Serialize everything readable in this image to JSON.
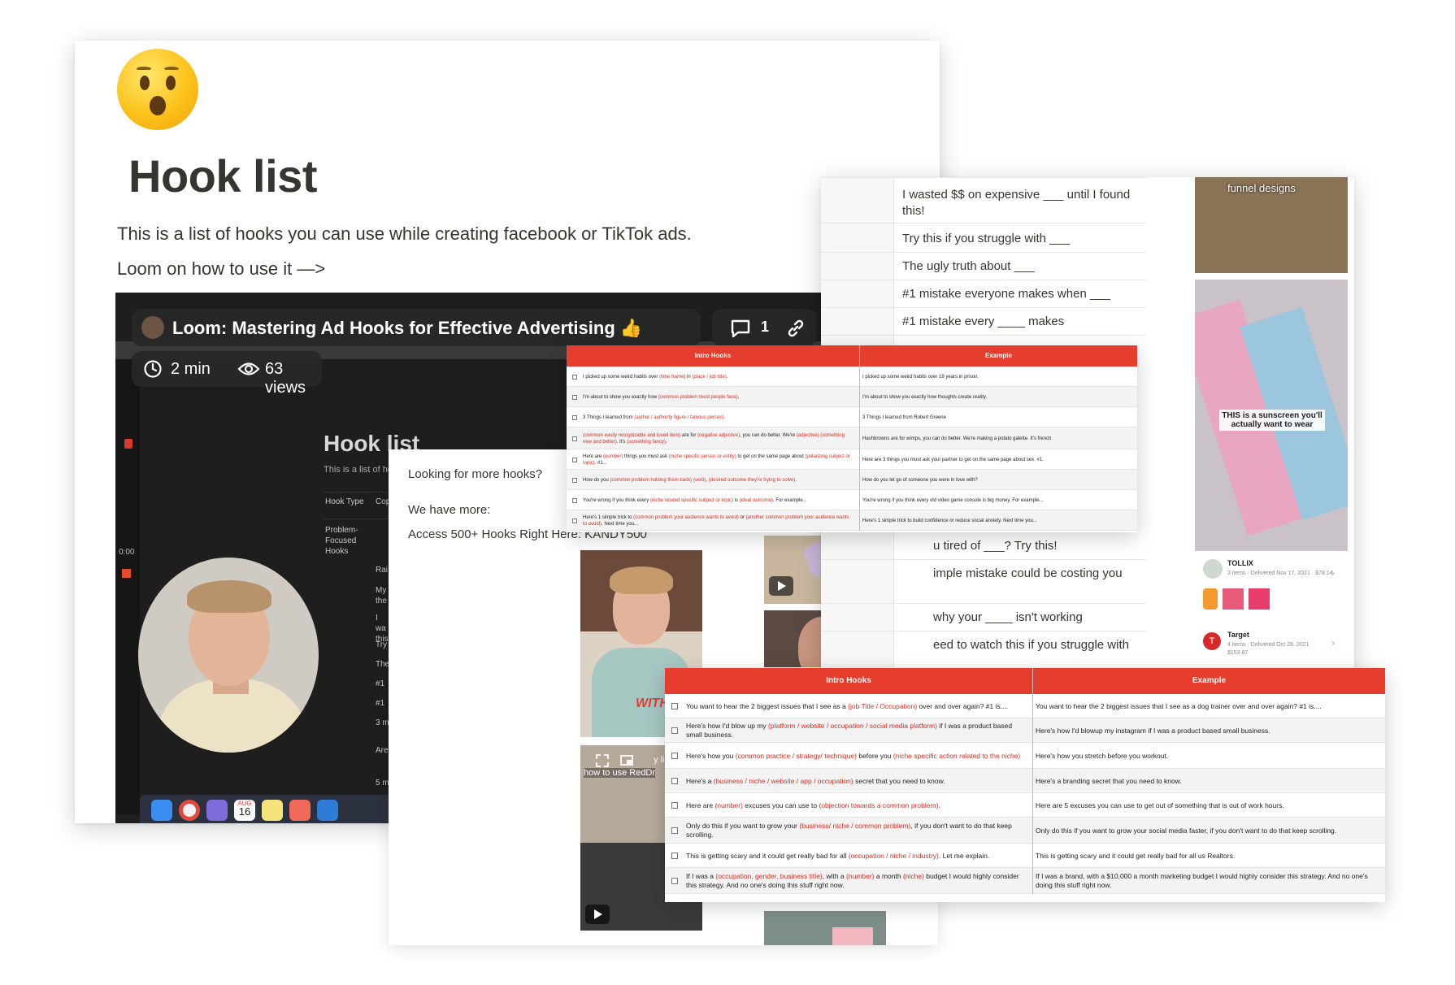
{
  "page": {
    "title": "Hook list",
    "description": "This is a list of hooks you can use while creating facebook or TikTok ads.",
    "loom_link_text": "Loom on how to use it —>"
  },
  "loom": {
    "title": "Loom: Mastering Ad Hooks for Effective Advertising 👍",
    "comment_count": "1",
    "duration": "2 min",
    "views": "63 views",
    "timer": "0:00",
    "inner_title": "Hook list",
    "inner_desc": "This is a list of ho",
    "inner_col_head": "Hook Type",
    "inner_col_head2": "Cop",
    "inner_row_label": "Problem-Focused Hooks",
    "inner_snippets": [
      "Rai",
      "My the",
      "I wa this",
      "Try",
      "The",
      "#1",
      "#1",
      "3 m",
      "Are",
      "5 m"
    ],
    "dock_date_month": "AUG",
    "dock_date_day": "16"
  },
  "more_hooks": {
    "question": "Looking for more hooks?",
    "have_more": "We have more:",
    "access": "Access 500+ Hooks Right Here: KANDY500",
    "thumb_caption_1": "WITH",
    "thumb_caption_2": "how to use RedDr",
    "thumb_caption_2b": "y littl"
  },
  "hook_list": {
    "rows": [
      "I wasted $$ on expensive ___ until I found this!",
      "Try this if you struggle with ___",
      "The ugly truth about ___",
      "#1 mistake everyone makes when ___",
      "#1 mistake every ____ makes"
    ],
    "lower_rows": [
      "u tired of ___? Try this!",
      "imple mistake could be costing you",
      "why your ____ isn't working",
      "eed to watch this if you struggle with"
    ],
    "image_caption_1": "funnel designs",
    "image_caption_2": "THIS is a sunscreen you'll actually want to wear",
    "order_1_store": "TOLLIX",
    "order_1_meta": "3 items · Delivered Nov 17, 2021 · $78.14",
    "order_2_store": "Target",
    "order_2_meta": "4 items · Delivered Oct 28, 2021",
    "order_2_price": "$153.87"
  },
  "table_small": {
    "headers": [
      "Intro Hooks",
      "Example"
    ],
    "rows": [
      {
        "hook": [
          [
            "I picked up some weird habits over ",
            ""
          ],
          [
            "(time frame)",
            "red"
          ],
          [
            " in ",
            ""
          ],
          [
            "(place / job title)",
            "red"
          ],
          [
            ".",
            ""
          ]
        ],
        "example": "I picked up some weird habits over 19 years in prison."
      },
      {
        "hook": [
          [
            "I'm about to show you exactly how ",
            ""
          ],
          [
            "(common problem most people face)",
            "red"
          ],
          [
            ".",
            ""
          ]
        ],
        "example": "I'm about to show you exactly how thoughts create reality."
      },
      {
        "hook": [
          [
            "3 Things I learned from ",
            ""
          ],
          [
            "(author / authority figure / famous person)",
            "red"
          ],
          [
            ".",
            ""
          ]
        ],
        "example": "3 Things I learned from Robert Greene"
      },
      {
        "hook": [
          [
            "(common easily recognizable and loved item)",
            "red"
          ],
          [
            " are for ",
            ""
          ],
          [
            "(negative adjective)",
            "red"
          ],
          [
            ", you can do better. We're ",
            ""
          ],
          [
            "(adjective)",
            "red"
          ],
          [
            " ",
            ""
          ],
          [
            "(something new and better)",
            "red"
          ],
          [
            ". It's ",
            ""
          ],
          [
            "(something fancy)",
            "red"
          ],
          [
            ".",
            ""
          ]
        ],
        "example": "Hashbrowns are for wimps, you can do better. We're making a potato galette. It's french"
      },
      {
        "hook": [
          [
            "Here are ",
            ""
          ],
          [
            "(number)",
            "red"
          ],
          [
            " things you must ask ",
            ""
          ],
          [
            "(niche specific person or entity)",
            "red"
          ],
          [
            " to get on the same page about ",
            ""
          ],
          [
            "(polarizing subject or topic)",
            "red"
          ],
          [
            ". #1...",
            ""
          ]
        ],
        "example": "Here are 3 things you must ask your partner to get on the same page about sex. #1."
      },
      {
        "hook": [
          [
            "How do you ",
            ""
          ],
          [
            "(common problem holding them back)",
            "red"
          ],
          [
            " ",
            ""
          ],
          [
            "(verb)",
            "red"
          ],
          [
            ", ",
            ""
          ],
          [
            "(desired outcome they're trying to solve)",
            "red"
          ],
          [
            ".",
            ""
          ]
        ],
        "example": "How do you let go of someone you were in love with?"
      },
      {
        "hook": [
          [
            "You're wrong if you think every ",
            ""
          ],
          [
            "(niche related specific subject or topic)",
            "red"
          ],
          [
            " is ",
            ""
          ],
          [
            "(ideal outcome)",
            "red"
          ],
          [
            ". For example...",
            ""
          ]
        ],
        "example": "You're wrong if you think every old video game console is big money. For example..."
      },
      {
        "hook": [
          [
            "Here's 1 simple trick to ",
            ""
          ],
          [
            "(common problem your audience wants to avoid)",
            "red"
          ],
          [
            " or ",
            ""
          ],
          [
            "(another common problem your audience wants to avoid)",
            "red"
          ],
          [
            ". Next time you...",
            ""
          ]
        ],
        "example": "Here's 1 simple trick to build confidence or reduce social anxiety. Next time you..."
      }
    ]
  },
  "table_large": {
    "headers": [
      "Intro Hooks",
      "Example"
    ],
    "rows": [
      {
        "hook": [
          [
            "You want to hear the 2 biggest issues that I see as a ",
            ""
          ],
          [
            "(job Title / Occupation)",
            "red"
          ],
          [
            " over and over again? #1 is....",
            ""
          ]
        ],
        "example": "You want to hear the 2 biggest issues that I see as a dog trainer over and over again? #1 is...."
      },
      {
        "hook": [
          [
            "Here's how I'd blow up my ",
            ""
          ],
          [
            "(platform / website / occupation / social media platform)",
            "red"
          ],
          [
            " if I was a product based small business.",
            ""
          ]
        ],
        "example": "Here's how I'd blowup my instagram if I was a product based small business."
      },
      {
        "hook": [
          [
            "Here's how you ",
            ""
          ],
          [
            "(common practice / strategy/ technique)",
            "red"
          ],
          [
            " before you ",
            ""
          ],
          [
            "(niche specific action related to the niche)",
            "red"
          ]
        ],
        "example": "Here's how you stretch before you workout."
      },
      {
        "hook": [
          [
            "Here's a ",
            ""
          ],
          [
            "(business / niche / website / app / occupation)",
            "red"
          ],
          [
            " secret that you need to know.",
            ""
          ]
        ],
        "example": "Here's a branding secret that you need to know."
      },
      {
        "hook": [
          [
            "Here are ",
            ""
          ],
          [
            "(number)",
            "red"
          ],
          [
            " excuses you can use to ",
            ""
          ],
          [
            "(objection towards a common problem)",
            "red"
          ],
          [
            ".",
            ""
          ]
        ],
        "example": "Here are 5 excuses you can use to get out of something that is out of work hours."
      },
      {
        "hook": [
          [
            "Only do this if you want to grow your ",
            ""
          ],
          [
            "(business/ niche / common problem)",
            "red"
          ],
          [
            ", if you don't want to do that keep scrolling.",
            ""
          ]
        ],
        "example": "Only do this if you want to grow your social media faster, if you don't want to do that keep scrolling."
      },
      {
        "hook": [
          [
            "This is getting scary and it could get really bad for all ",
            ""
          ],
          [
            "(occupation / niche / industry)",
            "red"
          ],
          [
            ". Let me explain.",
            ""
          ]
        ],
        "example": "This is getting scary and it could get really bad for all us Realtors."
      },
      {
        "hook": [
          [
            "If I was a ",
            ""
          ],
          [
            "(occupation, gender, business title)",
            "red"
          ],
          [
            ", with a ",
            ""
          ],
          [
            "(number)",
            "red"
          ],
          [
            " a month ",
            ""
          ],
          [
            "(niche)",
            "red"
          ],
          [
            " budget I would highly consider this strategy. And no one's doing this stuff right now.",
            ""
          ]
        ],
        "example": "If I was a brand, with a $10,000 a month marketing budget I would highly consider this strategy. And no one's doing this stuff right now."
      }
    ]
  },
  "colors": {
    "table_header": "#e53e2f",
    "placeholder_text": "#e02a1c",
    "loom_bg": "#1e1e1e"
  },
  "icons": [
    "astonished-face-emoji",
    "clock-icon",
    "eye-icon",
    "comment-icon",
    "link-icon",
    "play-icon",
    "expand-icon",
    "pip-icon",
    "checkbox-icon"
  ]
}
